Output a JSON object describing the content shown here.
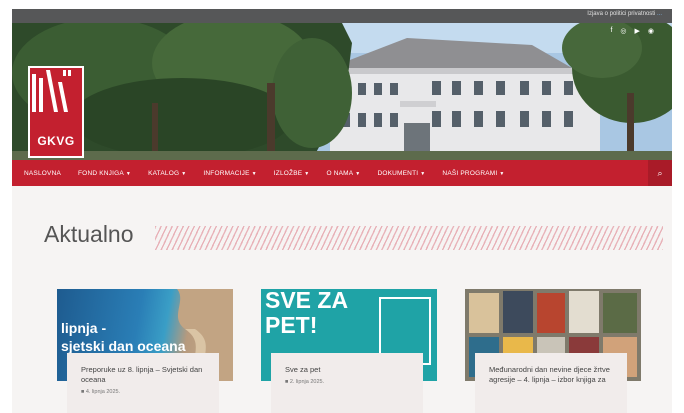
{
  "topbar": {
    "text": "Izjava o politici privatnosti",
    "link": "..."
  },
  "hero": {
    "icons": [
      "facebook-icon",
      "instagram-icon",
      "youtube-icon",
      "rss-icon"
    ]
  },
  "logo": {
    "text": "GKVG"
  },
  "nav": {
    "items": [
      {
        "label": "NASLOVNA",
        "caret": ""
      },
      {
        "label": "FOND KNJIGA",
        "caret": "▼"
      },
      {
        "label": "KATALOG",
        "caret": "▼"
      },
      {
        "label": "INFORMACIJE",
        "caret": "▼"
      },
      {
        "label": "IZLOŽBE",
        "caret": "▼"
      },
      {
        "label": "O NAMA",
        "caret": "▼"
      },
      {
        "label": "DOKUMENTI",
        "caret": "▼"
      },
      {
        "label": "NAŠI PROGRAMI",
        "caret": "▼"
      }
    ],
    "search_icon": "search-icon",
    "search_glyph": "⌕"
  },
  "section": {
    "title": "Aktualno"
  },
  "cards": [
    {
      "image_text": "lipnja -\nsjetski dan oceana",
      "title": "Preporuke uz 8. lipnja – Svjetski dan oceana",
      "date": "■ 4. lipnja 2025."
    },
    {
      "image_text": "SVE ZA\nPET!",
      "title": "Sve za pet",
      "date": "■ 2. lipnja 2025."
    },
    {
      "image_text": "",
      "title": "Međunarodni dan nevine djece žrtve agresije – 4. lipnja – izbor knjiga za",
      "date": ""
    }
  ],
  "colors": {
    "brand_red": "#c3202f",
    "topbar": "#565758",
    "page_bg": "#f6f4f3"
  }
}
